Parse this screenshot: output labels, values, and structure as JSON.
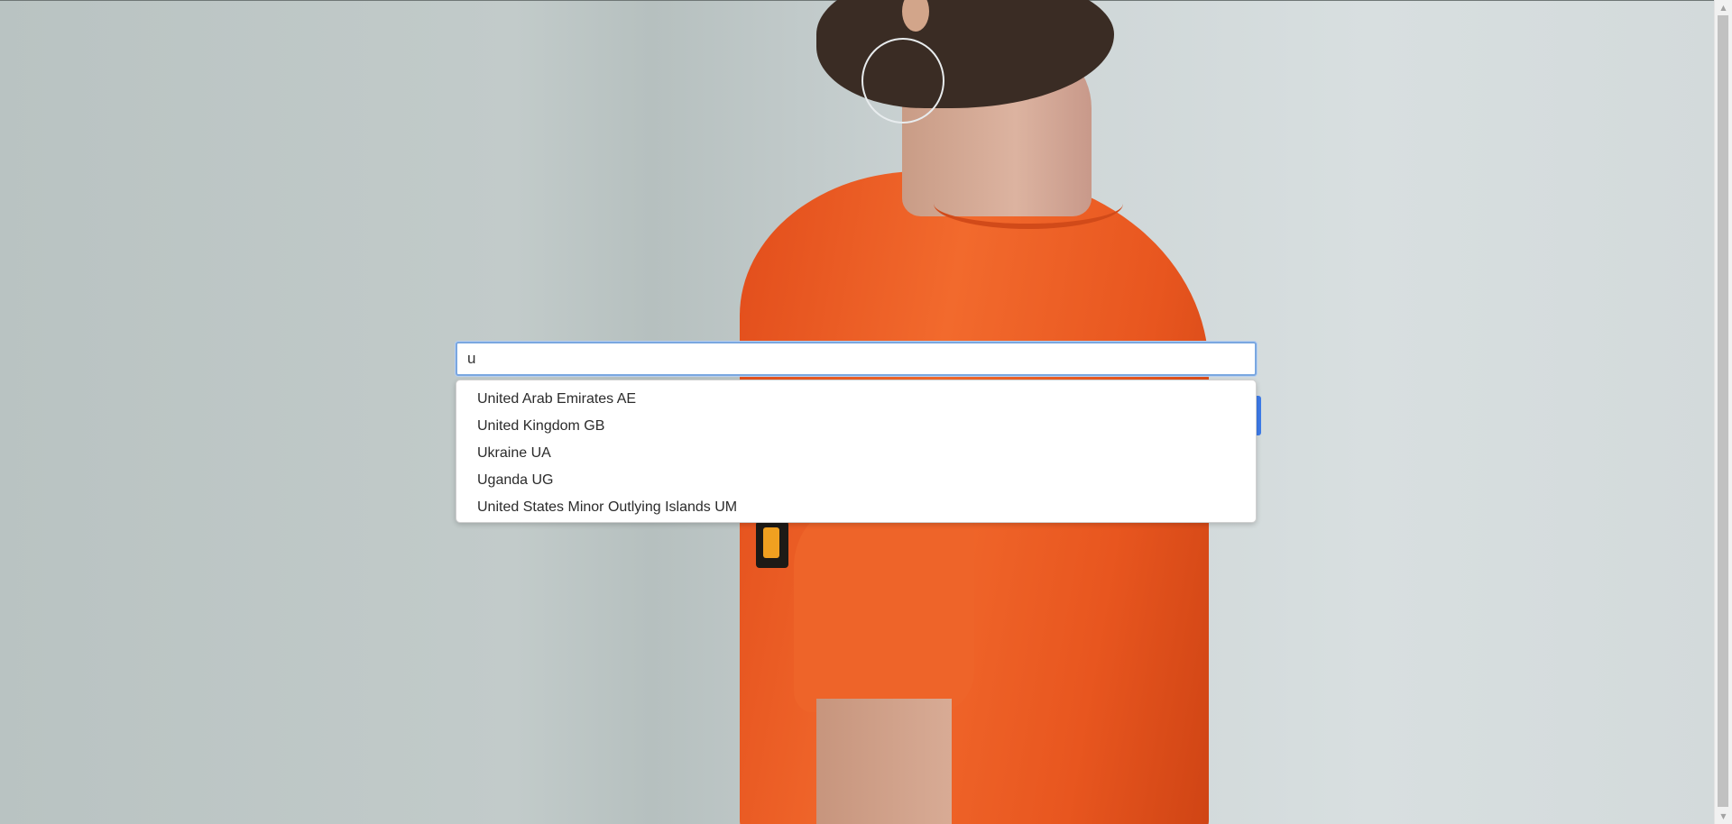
{
  "search": {
    "value": "u"
  },
  "suggestions": [
    "United Arab Emirates AE",
    "United Kingdom GB",
    "Ukraine UA",
    "Uganda UG",
    "United States Minor Outlying Islands UM"
  ],
  "scrollbar": {
    "up_icon": "triangle-up",
    "down_icon": "triangle-down"
  },
  "colors": {
    "input_focus_border": "#7aa7e0",
    "button_blue": "#3d7be8",
    "shirt_orange": "#f26a2d"
  }
}
